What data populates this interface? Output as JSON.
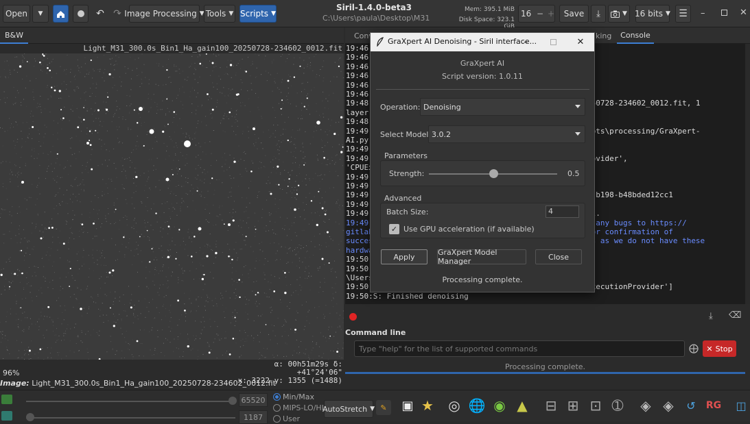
{
  "toolbar": {
    "open_label": "Open",
    "image_processing_label": "Image Processing",
    "tools_label": "Tools",
    "scripts_label": "Scripts",
    "app_title": "Siril-1.4.0-beta3",
    "app_path": "C:\\Users\\paula\\Desktop\\M31",
    "mem": "Mem: 395.1 MiB",
    "disk": "Disk Space: 323.1 GiB",
    "threads_value": "16",
    "save_label": "Save",
    "bits_label": "16 bits"
  },
  "left": {
    "tab_label": "B&W",
    "image_filename": "Light_M31_300.0s_Bin1_Ha_gain100_20250728-234602_0012.fit",
    "coord_line1": "α: 00h51m29s δ: +41°24'06\"",
    "coord_line2": "x: 3222 y: 1355 (=1488)",
    "zoom": "96%",
    "info_prefix": "Image:",
    "info_value": "Light_M31_300.0s_Bin1_Ha_gain100_20250728-234602_0012.fit"
  },
  "bottom": {
    "hi_value": "65520",
    "lo_value": "1187",
    "radio_minmax": "Min/Max",
    "radio_mips": "MIPS-LO/HI",
    "radio_user": "User",
    "stretch_label": "AutoStretch"
  },
  "right": {
    "tab_conversion": "Conv",
    "tab_stacking": "king",
    "tab_console": "Console",
    "console_lines": [
      {
        "t": "19:46:",
        "c": ""
      },
      {
        "t": "19:46:",
        "c": ""
      },
      {
        "t": "19:46:                                         ler.py",
        "c": ""
      },
      {
        "t": "19:46:",
        "c": ""
      },
      {
        "t": "19:46:",
        "c": ""
      },
      {
        "t": "19:46:",
        "c": ""
      },
      {
        "t": "19:48:                                         100_20250728-234602_0012.fit, 1",
        "c": ""
      },
      {
        "t": "layer(",
        "c": ""
      },
      {
        "t": "19:48:                                         UT",
        "c": ""
      },
      {
        "t": "19:49:                                         il-scripts\\processing/GraXpert-",
        "c": ""
      },
      {
        "t": "AI.py",
        "c": ""
      },
      {
        "t": "19:49:",
        "c": ""
      },
      {
        "t": "19:49:                                         utionProvider',",
        "c": ""
      },
      {
        "t": "'CPUEx",
        "c": ""
      },
      {
        "t": "19:49:",
        "c": ""
      },
      {
        "t": "19:49:",
        "c": ""
      },
      {
        "t": "19:49:                                         db-4037-b198-b48bded12cc1",
        "c": ""
      },
      {
        "t": "19:49:",
        "c": ""
      },
      {
        "t": "19:49:                                         of Siril.",
        "c": ""
      },
      {
        "t": "19:49:                                          report any bugs to https://",
        "c": "blue"
      },
      {
        "t": "gitlab                                        / keen for confirmation of",
        "c": "blue"
      },
      {
        "t": "succes                                         ARC GPUs as we do not have these",
        "c": "blue"
      },
      {
        "t": "hardwa",
        "c": "blue"
      },
      {
        "t": "19:50:",
        "c": ""
      },
      {
        "t": "19:50:",
        "c": ""
      },
      {
        "t": "\\Users",
        "c": ""
      },
      {
        "t": "19:50:                                        ', 'CPUExecutionProvider']",
        "c": ""
      },
      {
        "t": "19:50:S: Finished denoising",
        "c": ""
      }
    ],
    "cmd_label": "Command line",
    "cmd_placeholder": "Type \"help\" for the list of supported commands",
    "stop_label": "Stop",
    "status": "Processing complete."
  },
  "dialog": {
    "title": "GraXpert AI Denoising - Siril interface...",
    "heading": "GraXpert AI",
    "version": "Script version: 1.0.11",
    "operation_label": "Operation:",
    "operation_value": "Denoising",
    "model_label": "Select Model:",
    "model_value": "3.0.2",
    "parameters_label": "Parameters",
    "strength_label": "Strength:",
    "strength_value": "0.5",
    "strength_fraction": 0.5,
    "advanced_label": "Advanced",
    "batch_label": "Batch Size:",
    "batch_value": "4",
    "gpu_label": "Use GPU acceleration (if available)",
    "gpu_checked": true,
    "apply_label": "Apply",
    "manager_label": "GraXpert Model Manager",
    "close_label": "Close",
    "status": "Processing complete."
  },
  "colors": {
    "accent": "#2f65ad",
    "stop": "#c62828",
    "console_link": "#6a8cff"
  }
}
